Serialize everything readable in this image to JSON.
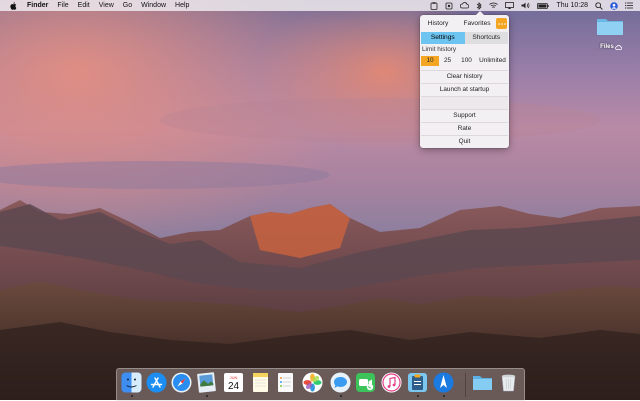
{
  "menubar": {
    "app_name": "Finder",
    "menus": [
      "File",
      "Edit",
      "View",
      "Go",
      "Window",
      "Help"
    ],
    "clock": "Thu 10:28"
  },
  "popover": {
    "tabs": {
      "history": "History",
      "favorites": "Favorites"
    },
    "segments": {
      "settings": "Settings",
      "shortcuts": "Shortcuts",
      "active": "settings"
    },
    "limit_label": "Limit history",
    "limit_options": [
      "10",
      "25",
      "100",
      "Unlimited"
    ],
    "limit_selected": "10",
    "clear_history": "Clear history",
    "launch_at_startup": "Launch at startup",
    "support": "Support",
    "rate": "Rate",
    "quit": "Quit",
    "accent_color": "#f4a623",
    "segment_color": "#6ec4f0"
  },
  "desktop": {
    "folder_label": "Files"
  },
  "dock": {
    "icons": [
      "finder-icon",
      "app-store-icon",
      "safari-icon",
      "preview-icon",
      "calendar-icon",
      "notes-icon",
      "reminders-icon",
      "photos-icon",
      "messages-icon",
      "facetime-icon",
      "itunes-icon",
      "clipboard-app-icon",
      "launchpad-icon",
      "downloads-folder-icon",
      "trash-icon"
    ],
    "calendar_month": "JUN",
    "calendar_day": "24"
  }
}
